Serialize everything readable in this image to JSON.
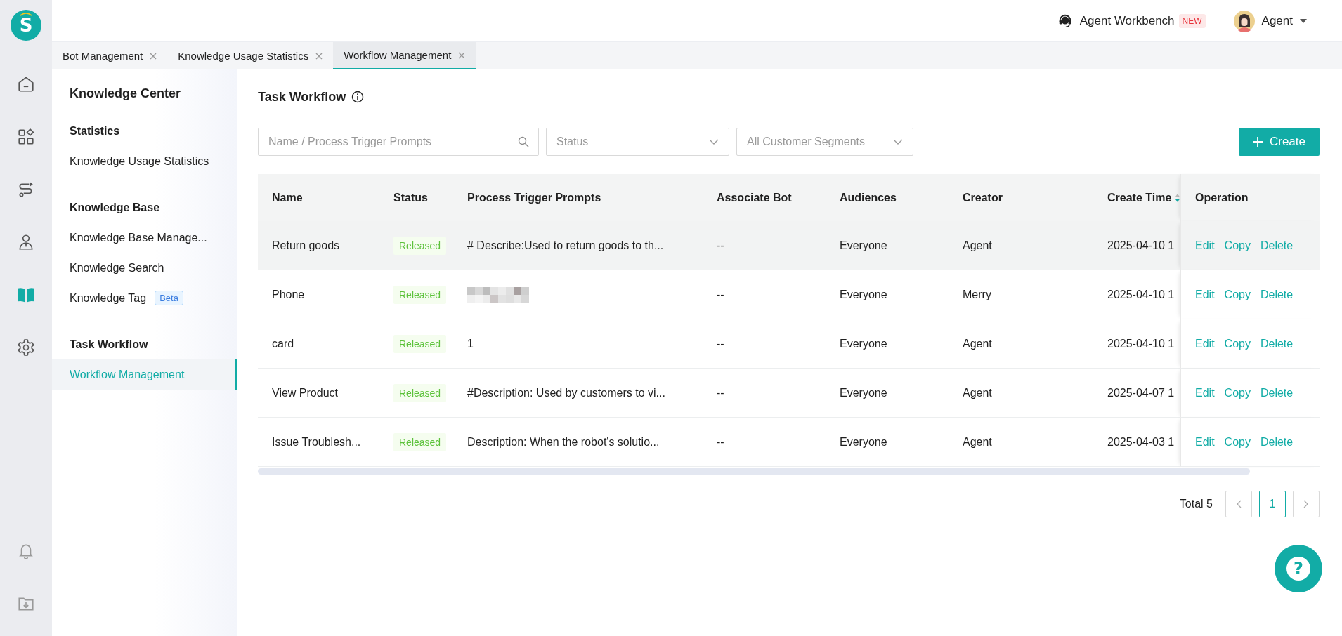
{
  "logo": {
    "letter": "S"
  },
  "rail": [
    {
      "kind": "home",
      "selected": false
    },
    {
      "kind": "apps",
      "selected": false
    },
    {
      "kind": "route",
      "selected": false
    },
    {
      "kind": "agent",
      "selected": false
    },
    {
      "kind": "book",
      "selected": true
    },
    {
      "kind": "settings",
      "selected": false
    }
  ],
  "rail_bottom": [
    {
      "kind": "bell"
    },
    {
      "kind": "download"
    }
  ],
  "topbar": {
    "workbench": {
      "label": "Agent Workbench",
      "badge": "NEW"
    },
    "user": {
      "name": "Agent"
    }
  },
  "tabs": [
    {
      "label": "Bot Management",
      "selected": false
    },
    {
      "label": "Knowledge Usage Statistics",
      "selected": false
    },
    {
      "label": "Workflow Management",
      "selected": true
    }
  ],
  "sidebar": {
    "title": "Knowledge Center",
    "sections": [
      {
        "heading": "Statistics",
        "items": [
          {
            "label": "Knowledge Usage Statistics",
            "selected": false
          }
        ]
      },
      {
        "heading": "Knowledge Base",
        "items": [
          {
            "label": "Knowledge Base Manage...",
            "selected": false
          },
          {
            "label": "Knowledge Search",
            "selected": false
          },
          {
            "label": "Knowledge Tag",
            "badge": "Beta",
            "selected": false
          }
        ]
      },
      {
        "heading": "Task Workflow",
        "items": [
          {
            "label": "Workflow Management",
            "selected": true
          }
        ]
      }
    ]
  },
  "page": {
    "title": "Task Workflow",
    "search": {
      "placeholder": "Name / Process Trigger Prompts"
    },
    "filters": [
      {
        "placeholder": "Status"
      },
      {
        "placeholder": "All Customer Segments"
      }
    ],
    "create_button": {
      "label": "Create"
    }
  },
  "table": {
    "columns": [
      "Name",
      "Status",
      "Process Trigger Prompts",
      "Associate Bot",
      "Audiences",
      "Creator",
      "Create Time",
      "Operation"
    ],
    "rows": [
      {
        "highlighted": true,
        "name": "Return goods",
        "status": "Released",
        "prompt": {
          "kind": "text",
          "text": "# Describe:Used to return goods to th..."
        },
        "bot": "--",
        "audiences": "Everyone",
        "creator": "Agent",
        "create_time": "2025-04-10 1",
        "actions": [
          "Edit",
          "Copy",
          "Delete"
        ]
      },
      {
        "highlighted": false,
        "name": "Phone",
        "status": "Released",
        "prompt": {
          "kind": "blurred"
        },
        "bot": "--",
        "audiences": "Everyone",
        "creator": "Merry",
        "create_time": "2025-04-10 1",
        "actions": [
          "Edit",
          "Copy",
          "Delete"
        ]
      },
      {
        "highlighted": false,
        "name": "card",
        "status": "Released",
        "prompt": {
          "kind": "text",
          "text": "1"
        },
        "bot": "--",
        "audiences": "Everyone",
        "creator": "Agent",
        "create_time": "2025-04-10 1",
        "actions": [
          "Edit",
          "Copy",
          "Delete"
        ]
      },
      {
        "highlighted": false,
        "name": "View Product",
        "status": "Released",
        "prompt": {
          "kind": "text",
          "text": "#Description: Used by customers to vi..."
        },
        "bot": "--",
        "audiences": "Everyone",
        "creator": "Agent",
        "create_time": "2025-04-07 1",
        "actions": [
          "Edit",
          "Copy",
          "Delete"
        ]
      },
      {
        "highlighted": false,
        "name": "Issue Troublesh...",
        "status": "Released",
        "prompt": {
          "kind": "text",
          "text": "Description: When the robot's solutio..."
        },
        "bot": "--",
        "audiences": "Everyone",
        "creator": "Agent",
        "create_time": "2025-04-03 1",
        "actions": [
          "Edit",
          "Copy",
          "Delete"
        ]
      }
    ]
  },
  "pagination": {
    "total": "Total 5",
    "pages": [
      {
        "label": "1",
        "selected": true
      }
    ]
  },
  "help_button": {
    "label": "?"
  }
}
